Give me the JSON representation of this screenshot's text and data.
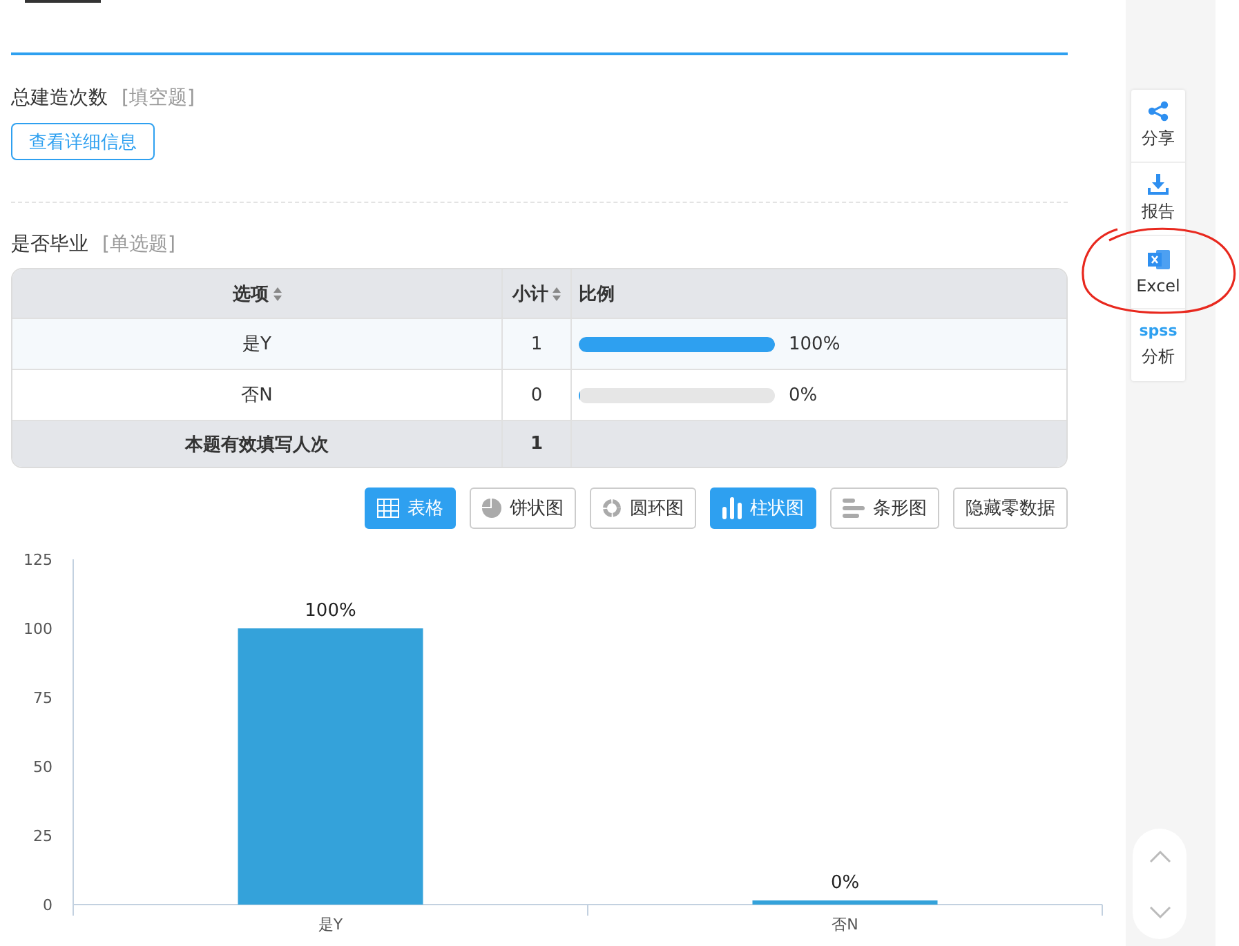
{
  "q1": {
    "title": "总建造次数",
    "type_tag": "[填空题]",
    "detail_button": "查看详细信息"
  },
  "q2": {
    "title": "是否毕业",
    "type_tag": "[单选题]",
    "table": {
      "columns": [
        {
          "label": "选项",
          "sortable": true
        },
        {
          "label": "小计",
          "sortable": true
        },
        {
          "label": "比例",
          "sortable": false
        }
      ],
      "rows": [
        {
          "option": "是Y",
          "count": "1",
          "level": 1,
          "percent": "100%"
        },
        {
          "option": "否N",
          "count": "0",
          "level": 0,
          "percent": "0%"
        }
      ],
      "footer": {
        "label": "本题有效填写人次",
        "count": "1"
      }
    },
    "view_buttons": [
      {
        "label": "表格",
        "kind": "table",
        "selected": true
      },
      {
        "label": "饼状图",
        "kind": "pie",
        "selected": false
      },
      {
        "label": "圆环图",
        "kind": "donut",
        "selected": false
      },
      {
        "label": "柱状图",
        "kind": "bar",
        "selected": true
      },
      {
        "label": "条形图",
        "kind": "hbar",
        "selected": false
      },
      {
        "label": "隐藏零数据",
        "kind": "plain",
        "selected": false
      }
    ],
    "chart_data": {
      "type": "bar",
      "categories": [
        "是Y",
        "否N"
      ],
      "series": [
        {
          "color": "#34a2da",
          "values": [
            100,
            0
          ]
        }
      ],
      "ylim": [
        0,
        125
      ],
      "yticks": [
        0,
        25,
        50,
        75,
        100,
        125
      ],
      "value_labels": [
        "100%",
        "0%"
      ]
    }
  },
  "side_tools": [
    {
      "kind": "share",
      "label": "分享"
    },
    {
      "kind": "download",
      "label": "报告"
    },
    {
      "kind": "excel",
      "label": "Excel"
    },
    {
      "kind": "spss",
      "badge": "spss",
      "label": "分析"
    }
  ]
}
